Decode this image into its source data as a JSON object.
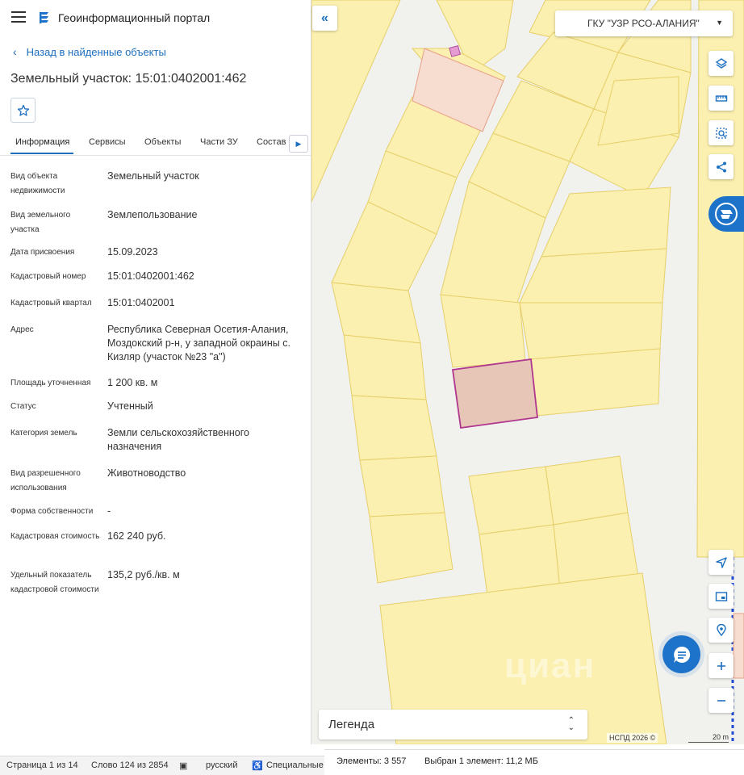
{
  "app": {
    "title": "Геоинформационный портал"
  },
  "nav": {
    "back_label": "Назад в найденные объекты"
  },
  "object": {
    "title": "Земельный участок: 15:01:0402001:462"
  },
  "tabs": [
    "Информация",
    "Сервисы",
    "Объекты",
    "Части ЗУ",
    "Состав"
  ],
  "active_tab": "Информация",
  "properties": [
    {
      "label": "Вид объекта недвижимости",
      "value": "Земельный участок"
    },
    {
      "label": "Вид земельного участка",
      "value": "Землепользование"
    },
    {
      "label": "Дата присвоения",
      "value": "15.09.2023"
    },
    {
      "label": "Кадастровый номер",
      "value": "15:01:0402001:462"
    },
    {
      "label": "Кадастровый квартал",
      "value": "15:01:0402001"
    },
    {
      "label": "Адрес",
      "value": "Республика Северная Осетия-Алания, Моздокский р-н, у западной окраины с. Кизляр (участок №23 \"а\")"
    },
    {
      "label": "Площадь уточненная",
      "value": "1 200 кв. м"
    },
    {
      "label": "Статус",
      "value": "Учтенный"
    },
    {
      "label": "Категория земель",
      "value": "Земли сельскохозяйственного назначения"
    },
    {
      "label": "Вид разрешенного использования",
      "value": "Животноводство"
    },
    {
      "label": "Форма собственности",
      "value": "-"
    },
    {
      "label": "Кадастровая стоимость",
      "value": "162 240 руб."
    },
    {
      "label": "Удельный показатель кадастровой стоимости",
      "value": "135,2 руб./кв. м"
    }
  ],
  "map": {
    "org_select": "ГКУ \"УЗР РСО-АЛАНИЯ\"",
    "legend_label": "Легенда",
    "copyright": "НСПД 2026 ©",
    "scale_label": "20 m",
    "watermark": "циан",
    "colors": {
      "parcel_fill": "#fbf0b0",
      "parcel_stroke": "#e6cf6a",
      "selected_stroke": "#b0368f",
      "selected_fill": "#e8c6b7",
      "accent": "#1d73c9"
    }
  },
  "status": {
    "elements": "Элементы: 3 557",
    "selected": "Выбран 1 элемент: 11,2 МБ"
  },
  "word_status": {
    "page": "Страница 1 из 14",
    "words": "Слово 124 из 2854",
    "language": "русский",
    "special": "Специальные"
  },
  "icons": [
    "menu-icon",
    "portal-logo-icon",
    "chevron-left-icon",
    "star-icon",
    "layers-icon",
    "ruler-icon",
    "select-area-icon",
    "share-icon",
    "navigate-icon",
    "minimap-icon",
    "location-icon",
    "zoom-in-icon",
    "zoom-out-icon",
    "chat-icon"
  ]
}
